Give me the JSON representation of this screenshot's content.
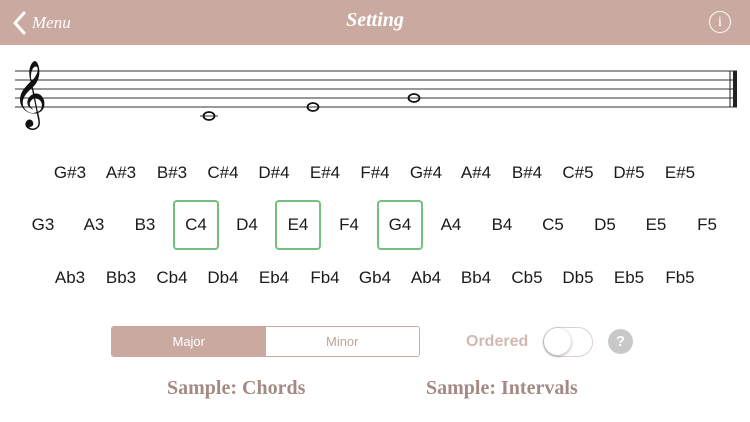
{
  "nav": {
    "back_label": "Menu",
    "title": "Setting",
    "info_label": "i",
    "colors": {
      "bar": "#caa9a1",
      "text": "#ffffff"
    }
  },
  "staff": {
    "clef": "treble-clef-icon",
    "notes": [
      "C4",
      "E4",
      "G4"
    ]
  },
  "notes": {
    "sharps": [
      "G#3",
      "A#3",
      "B#3",
      "C#4",
      "D#4",
      "E#4",
      "F#4",
      "G#4",
      "A#4",
      "B#4",
      "C#5",
      "D#5",
      "E#5"
    ],
    "naturals": [
      "G3",
      "A3",
      "B3",
      "C4",
      "D4",
      "E4",
      "F4",
      "G4",
      "A4",
      "B4",
      "C5",
      "D5",
      "E5",
      "F5"
    ],
    "flats": [
      "Ab3",
      "Bb3",
      "Cb4",
      "Db4",
      "Eb4",
      "Fb4",
      "Gb4",
      "Ab4",
      "Bb4",
      "Cb5",
      "Db5",
      "Eb5",
      "Fb5"
    ],
    "selected": [
      "C4",
      "E4",
      "G4"
    ],
    "selected_color": "#74c080"
  },
  "mode": {
    "options": [
      "Major",
      "Minor"
    ],
    "selected": "Major"
  },
  "ordered": {
    "label": "Ordered",
    "enabled": false
  },
  "help_label": "?",
  "samples": {
    "chords": "Sample: Chords",
    "intervals": "Sample: Intervals"
  }
}
